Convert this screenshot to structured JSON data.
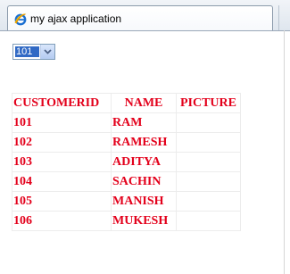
{
  "tab": {
    "title": "my ajax application",
    "icon": "ie-browser-icon"
  },
  "select": {
    "value": "101",
    "arrow_icon": "chevron-down-icon"
  },
  "table": {
    "headers": [
      "CUSTOMERID",
      "NAME",
      "PICTURE"
    ],
    "rows": [
      {
        "id": "101",
        "name": "RAM",
        "picture": ""
      },
      {
        "id": "102",
        "name": "RAMESH",
        "picture": ""
      },
      {
        "id": "103",
        "name": "ADITYA",
        "picture": ""
      },
      {
        "id": "104",
        "name": "SACHIN",
        "picture": ""
      },
      {
        "id": "105",
        "name": "MANISH",
        "picture": ""
      },
      {
        "id": "106",
        "name": "MUKESH",
        "picture": ""
      }
    ]
  },
  "colors": {
    "table_text": "#e3001b",
    "select_highlight": "#316ac5"
  }
}
